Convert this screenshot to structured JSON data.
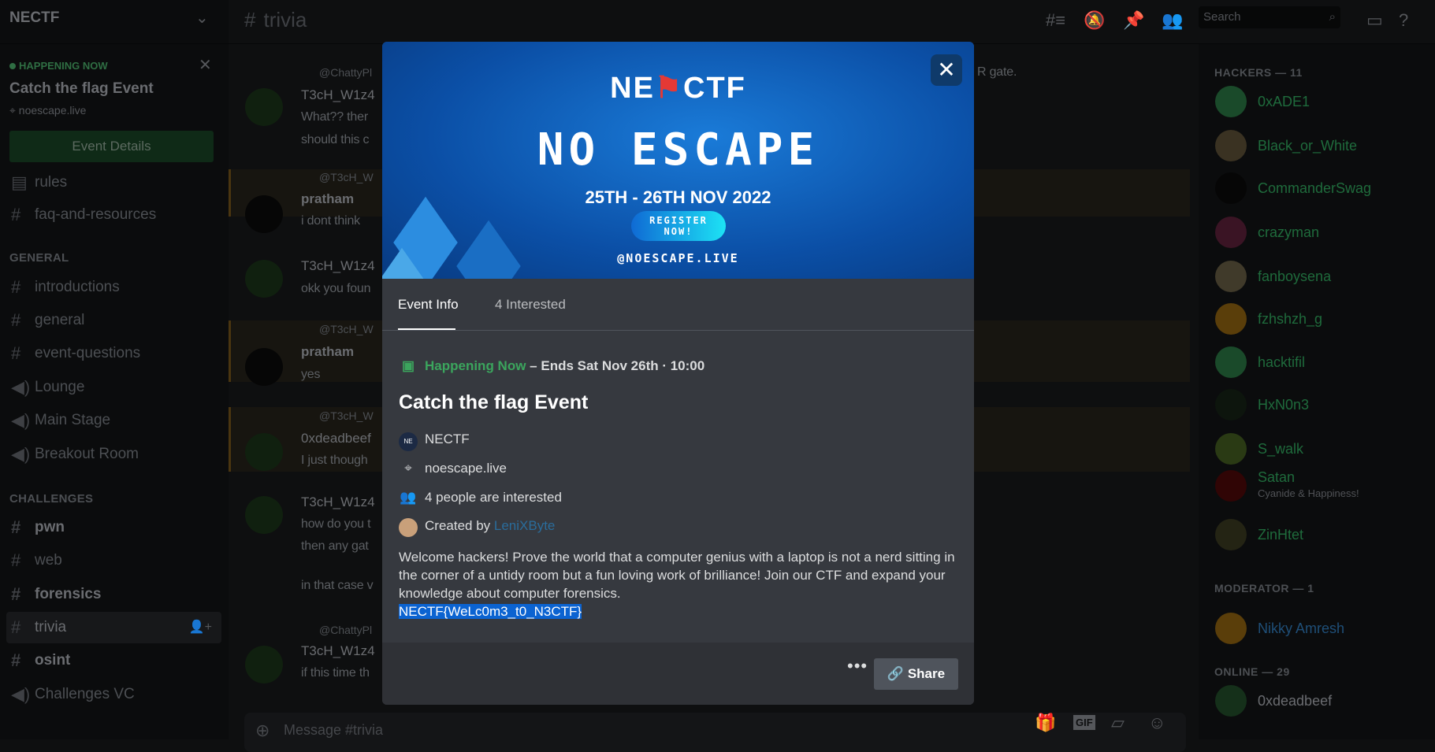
{
  "server": {
    "name": "NECTF"
  },
  "event_banner": {
    "status": "HAPPENING NOW",
    "title": "Catch the flag Event",
    "location": "noescape.live",
    "button": "Event Details"
  },
  "channels": [
    {
      "label": "rules",
      "icon": "rules-icon"
    },
    {
      "label": "faq-and-resources",
      "icon": "hash-icon"
    },
    {
      "category": "GENERAL"
    },
    {
      "label": "introductions",
      "icon": "hash-icon"
    },
    {
      "label": "general",
      "icon": "hash-icon"
    },
    {
      "label": "event-questions",
      "icon": "hash-icon"
    },
    {
      "label": "Lounge",
      "icon": "speaker-icon"
    },
    {
      "label": "Main Stage",
      "icon": "speaker-icon"
    },
    {
      "label": "Breakout Room",
      "icon": "speaker-icon"
    },
    {
      "category": "CHALLENGES"
    },
    {
      "label": "pwn",
      "icon": "hash-icon",
      "unread": true
    },
    {
      "label": "web",
      "icon": "hash-icon"
    },
    {
      "label": "forensics",
      "icon": "hash-icon",
      "unread": true
    },
    {
      "label": "trivia",
      "icon": "hash-icon",
      "selected": true
    },
    {
      "label": "osint",
      "icon": "hash-icon",
      "unread": true
    },
    {
      "label": "Challenges VC",
      "icon": "speaker-icon"
    }
  ],
  "header": {
    "channel": "trivia",
    "search_placeholder": "Search"
  },
  "messages": [
    {
      "reply": "@ChattyPl",
      "author": "T3cH_W1z4",
      "lines": [
        "What?? ther",
        "should this c"
      ],
      "tail": "R gate."
    },
    {
      "reply": "@T3cH_W",
      "author": "pratham",
      "lines": [
        "i dont think"
      ]
    },
    {
      "author": "T3cH_W1z4",
      "lines": [
        "okk you foun"
      ]
    },
    {
      "reply": "@T3cH_W",
      "author": "pratham",
      "lines": [
        "yes"
      ]
    },
    {
      "reply": "@T3cH_W",
      "author": "0xdeadbeef",
      "lines": [
        "I just though"
      ]
    },
    {
      "author": "T3cH_W1z4",
      "lines": [
        "how do you t",
        "then any gat",
        "in that case v"
      ]
    },
    {
      "reply": "@ChattyPl",
      "author": "T3cH_W1z4",
      "lines": [
        "if this time th"
      ]
    }
  ],
  "composer": {
    "placeholder": "Message #trivia"
  },
  "members": {
    "groups": [
      {
        "title": "HACKERS — 11",
        "items": [
          {
            "name": "0xADE1"
          },
          {
            "name": "Black_or_White"
          },
          {
            "name": "CommanderSwag"
          },
          {
            "name": "crazyman"
          },
          {
            "name": "fanboysena"
          },
          {
            "name": "fzhshzh_g"
          },
          {
            "name": "hacktifil"
          },
          {
            "name": "HxN0n3"
          },
          {
            "name": "S_walk"
          },
          {
            "name": "Satan",
            "status": "Cyanide & Happiness!"
          },
          {
            "name": "ZinHtet"
          }
        ]
      },
      {
        "title": "MODERATOR — 1",
        "items": [
          {
            "name": "Nikky Amresh"
          }
        ]
      },
      {
        "title": "ONLINE — 29",
        "items": [
          {
            "name": "0xdeadbeef"
          }
        ]
      }
    ]
  },
  "modal": {
    "banner": {
      "logo_left": "NE",
      "logo_right": "CTF",
      "title": "NO ESCAPE",
      "dates": "25TH - 26TH NOV 2022",
      "register": "REGISTER NOW!",
      "handle": "@NOESCAPE.LIVE"
    },
    "tabs": [
      {
        "label": "Event Info",
        "active": true
      },
      {
        "label": "4 Interested"
      }
    ],
    "status": "Happening Now",
    "ends": " – Ends Sat Nov 26th · 10:00",
    "title": "Catch the flag Event",
    "server": "NECTF",
    "location": "noescape.live",
    "interested": "4 people are interested",
    "created_by_label": "Created by ",
    "creator": "LeniXByte",
    "description": "Welcome hackers! Prove the world that a computer genius with a laptop is not a nerd sitting in the corner of a untidy room but a fun loving work of brilliance! Join our CTF and expand your knowledge about computer forensics.",
    "flag": "NECTF{WeLc0m3_t0_N3CTF}",
    "share": "Share"
  },
  "colors": {
    "accent_green": "#3ba55d",
    "link": "#2a6c9b",
    "selection": "#0b63d1",
    "member_green": "#2ecc71"
  }
}
